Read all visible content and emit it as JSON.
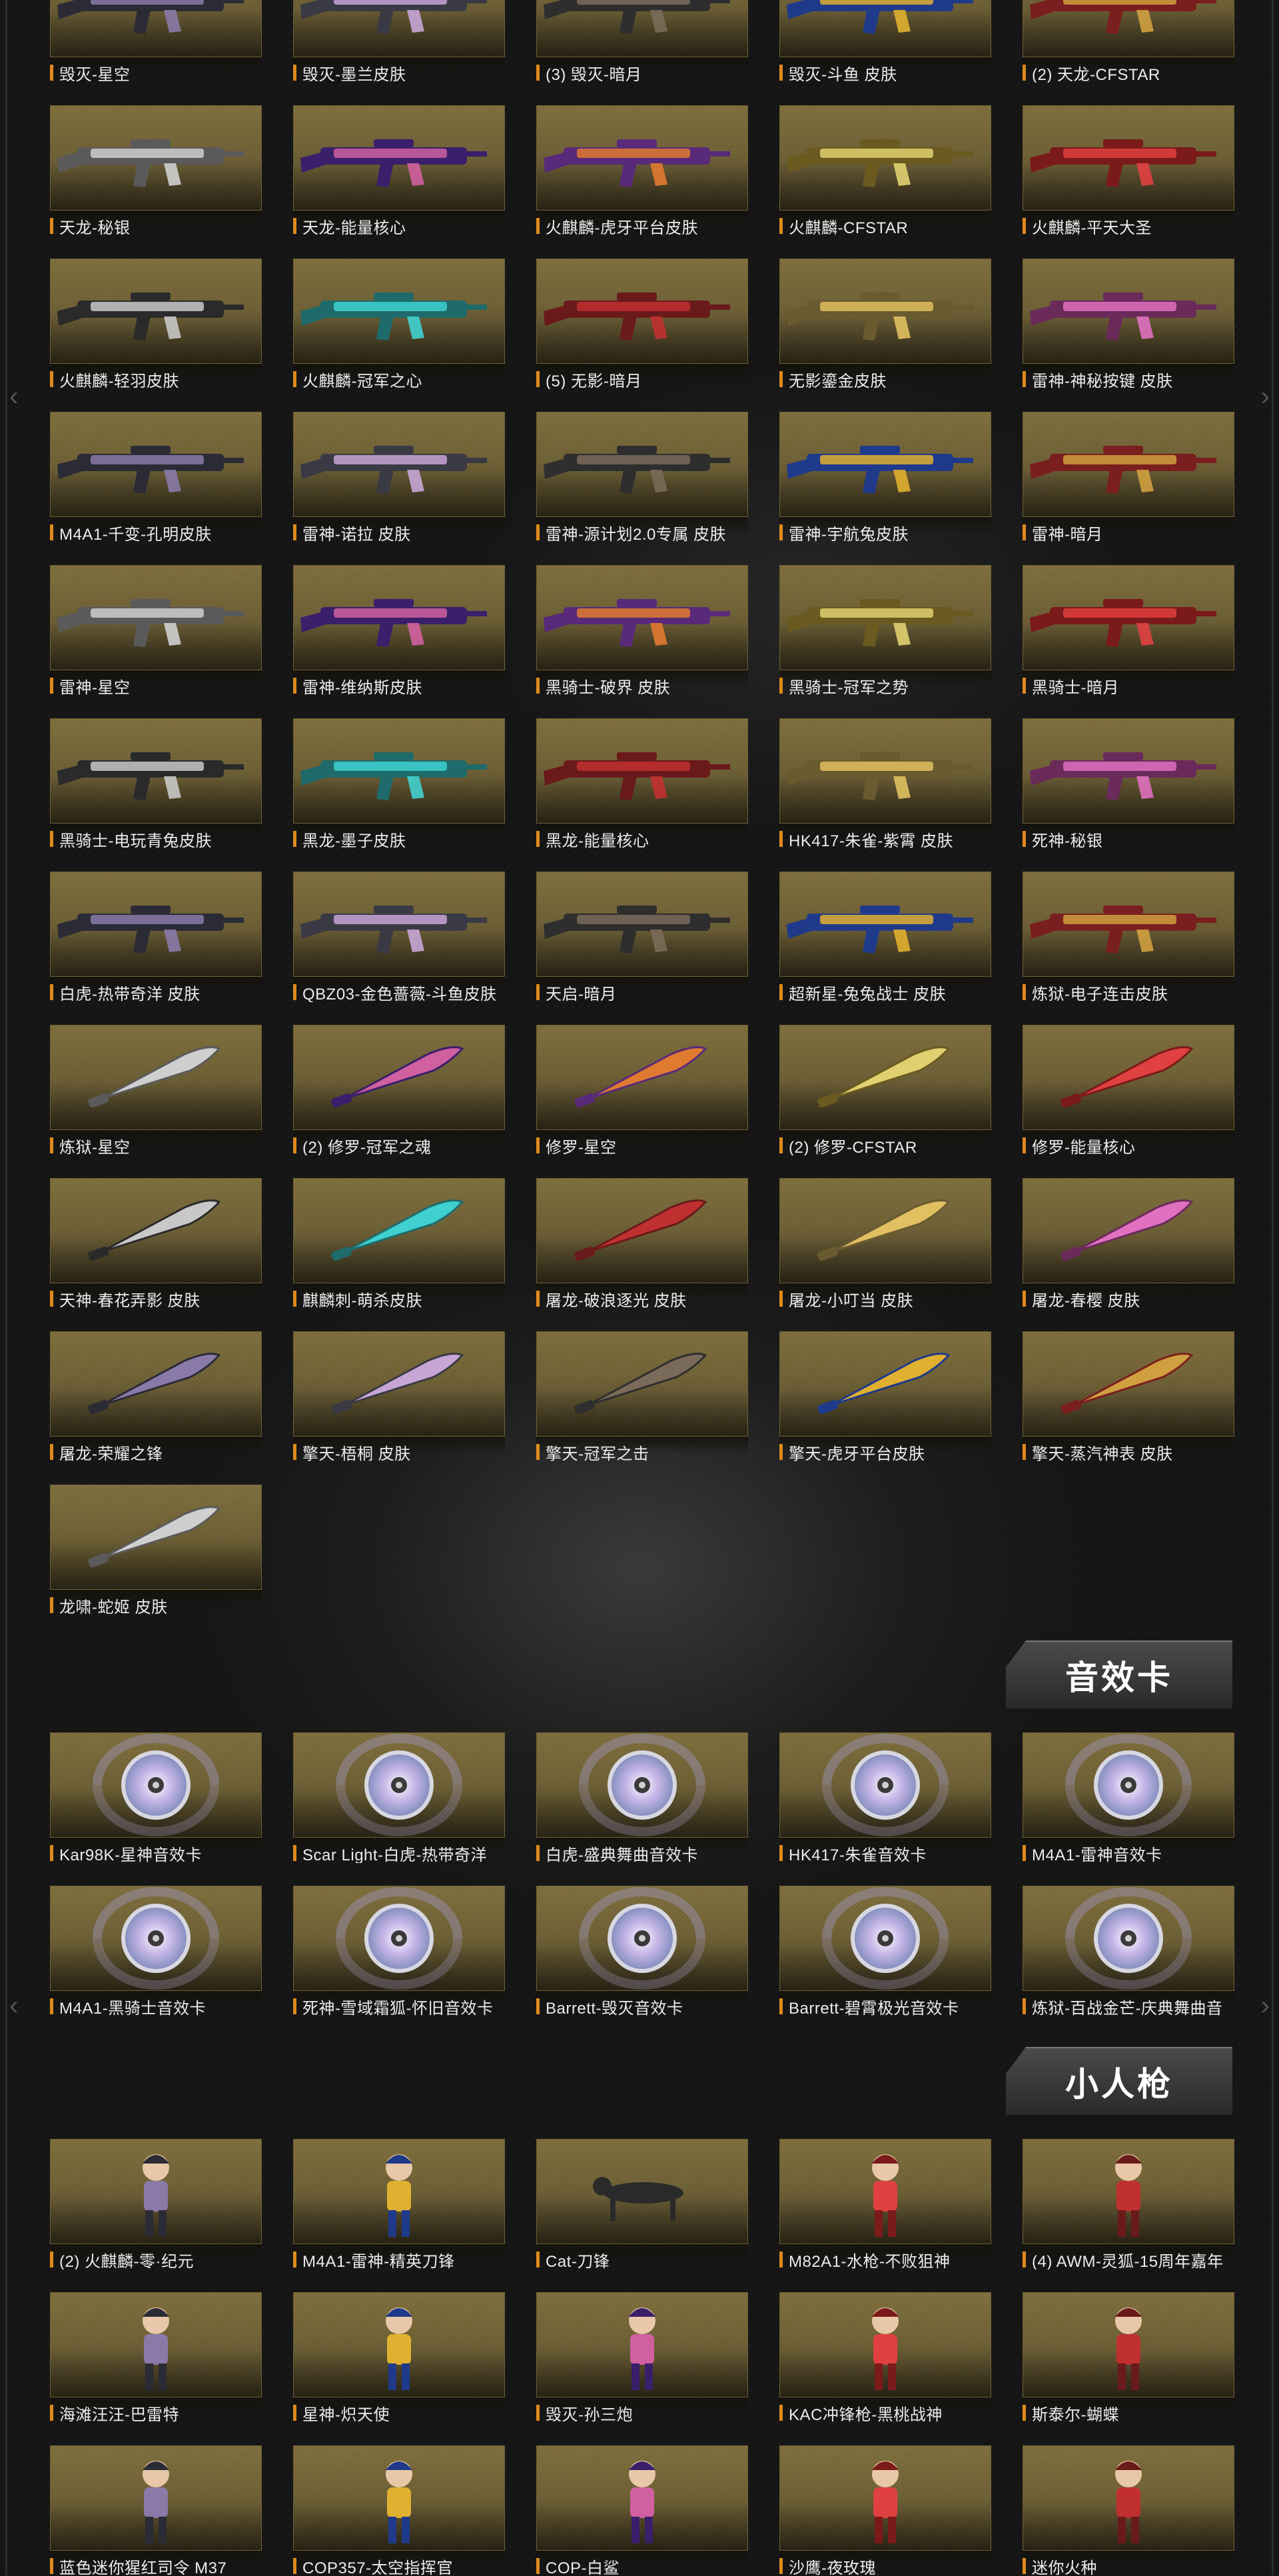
{
  "weapons": [
    "毁灭-星空",
    "毁灭-墨兰皮肤",
    "(3) 毁灭-暗月",
    "毁灭-斗鱼 皮肤",
    "(2) 天龙-CFSTAR",
    "天龙-秘银",
    "天龙-能量核心",
    "火麒麟-虎牙平台皮肤",
    "火麒麟-CFSTAR",
    "火麒麟-平天大圣",
    "火麒麟-轻羽皮肤",
    "火麒麟-冠军之心",
    "(5) 无影-暗月",
    "无影鎏金皮肤",
    "雷神-神秘按键 皮肤",
    "M4A1-千变-孔明皮肤",
    "雷神-诺拉 皮肤",
    "雷神-源计划2.0专属 皮肤",
    "雷神-宇航兔皮肤",
    "雷神-暗月",
    "雷神-星空",
    "雷神-维纳斯皮肤",
    "黑骑士-破界 皮肤",
    "黑骑士-冠军之势",
    "黑骑士-暗月",
    "黑骑士-电玩青兔皮肤",
    "黑龙-墨子皮肤",
    "黑龙-能量核心",
    "HK417-朱雀-紫霄 皮肤",
    "死神-秘银",
    "白虎-热带奇洋 皮肤",
    "QBZ03-金色蔷薇-斗鱼皮肤",
    "天启-暗月",
    "超新星-兔兔战士 皮肤",
    "炼狱-电子连击皮肤",
    "炼狱-星空",
    "(2) 修罗-冠军之魂",
    "修罗-星空",
    "(2) 修罗-CFSTAR",
    "修罗-能量核心",
    "天神-春花弄影 皮肤",
    "麒麟刺-萌杀皮肤",
    "屠龙-破浪逐光 皮肤",
    "屠龙-小叮当 皮肤",
    "屠龙-春樱 皮肤",
    "屠龙-荣耀之锋",
    "擎天-梧桐 皮肤",
    "擎天-冠军之击",
    "擎天-虎牙平台皮肤",
    "擎天-蒸汽神表 皮肤",
    "龙啸-蛇姬 皮肤"
  ],
  "sections": {
    "sound": "音效卡",
    "chars": "小人枪"
  },
  "sound_cards": [
    "Kar98K-星神音效卡",
    "Scar Light-白虎-热带奇洋",
    "白虎-盛典舞曲音效卡",
    "HK417-朱雀音效卡",
    "M4A1-雷神音效卡",
    "M4A1-黑骑士音效卡",
    "死神-雪域霜狐-怀旧音效卡",
    "Barrett-毁灭音效卡",
    "Barrett-碧霄极光音效卡",
    "炼狱-百战金芒-庆典舞曲音"
  ],
  "characters": [
    "(2) 火麒麟-零·纪元",
    "M4A1-雷神-精英刀锋",
    "Cat-刀锋",
    "M82A1-水枪-不败狙神",
    "(4) AWM-灵狐-15周年嘉年",
    "海滩汪汪-巴雷特",
    "星神-炽天使",
    "毁灭-孙三炮",
    "KAC冲锋枪-黑桃战神",
    "斯泰尔-蝴蝶",
    "蓝色迷你猩红司令 M37",
    "COP357-太空指挥官",
    "COP-白鲨",
    "沙鹰-夜玫瑰",
    "迷你火种"
  ],
  "colors": {
    "card_gold": "#7d6d3b",
    "label_accent": "#e08a1c",
    "label_text": "#ececec",
    "background": "#151515"
  }
}
